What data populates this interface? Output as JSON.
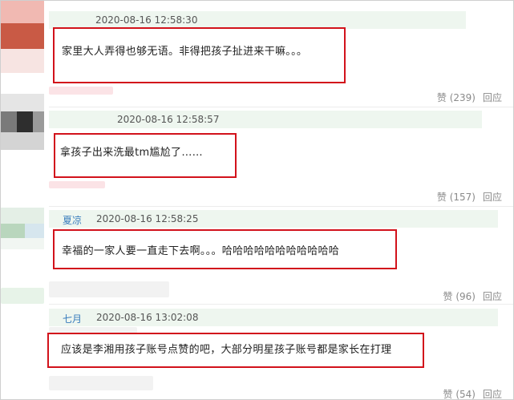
{
  "comments": [
    {
      "author": "",
      "time": "2020-08-16 12:58:30",
      "text": "家里大人弄得也够无语。非得把孩子扯进来干嘛。。。",
      "like_label": "赞",
      "like_count": "(239)",
      "reply_label": "回应"
    },
    {
      "author": "",
      "time": "2020-08-16 12:58:57",
      "text": "拿孩子出来洗最tm尴尬了……",
      "like_label": "赞",
      "like_count": "(157)",
      "reply_label": "回应"
    },
    {
      "author": "夏凉",
      "time": "2020-08-16 12:58:25",
      "text": "幸福的一家人要一直走下去啊。。。哈哈哈哈哈哈哈哈哈哈哈",
      "like_label": "赞",
      "like_count": "(96)",
      "reply_label": "回应"
    },
    {
      "author": "七月",
      "time": "2020-08-16 13:02:08",
      "text": "应该是李湘用孩子账号点赞的吧，大部分明星孩子账号都是家长在打理",
      "like_label": "赞",
      "like_count": "(54)",
      "reply_label": "回应"
    }
  ],
  "colors": {
    "highlight_border": "#d2121b",
    "meta_background": "#eef6ef",
    "author_link": "#3a7dbd"
  }
}
